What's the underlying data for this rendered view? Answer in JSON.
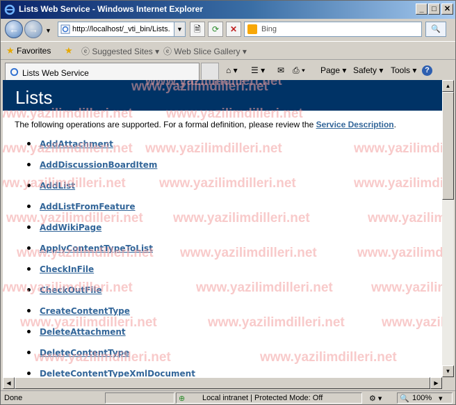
{
  "window": {
    "title": "Lists Web Service - Windows Internet Explorer",
    "min": "_",
    "max": "□",
    "close": "✕"
  },
  "nav": {
    "back": "←",
    "forward": "→",
    "address": "http://localhost/_vti_bin/Lists.",
    "search_placeholder": "Bing",
    "search_go": "🔍"
  },
  "favorites_bar": {
    "favorites": "Favorites",
    "suggested_sites": "Suggested Sites",
    "web_slice_gallery": "Web Slice Gallery"
  },
  "tab": {
    "label": "Lists Web Service"
  },
  "command_bar": {
    "page": "Page",
    "safety": "Safety",
    "tools": "Tools",
    "help": "?"
  },
  "page": {
    "heading": "Lists",
    "intro_text": "The following operations are supported. For a formal definition, please review the ",
    "intro_link": "Service Description",
    "intro_end": ".",
    "operations": [
      "AddAttachment",
      "AddDiscussionBoardItem",
      "AddList",
      "AddListFromFeature",
      "AddWikiPage",
      "ApplyContentTypeToList",
      "CheckInFile",
      "CheckOutFile",
      "CreateContentType",
      "DeleteAttachment",
      "DeleteContentType",
      "DeleteContentTypeXmlDocument"
    ]
  },
  "watermark": "www.yazilimdilleri.net",
  "status": {
    "done": "Done",
    "zone": "Local intranet | Protected Mode: Off",
    "zoom": "100%"
  }
}
